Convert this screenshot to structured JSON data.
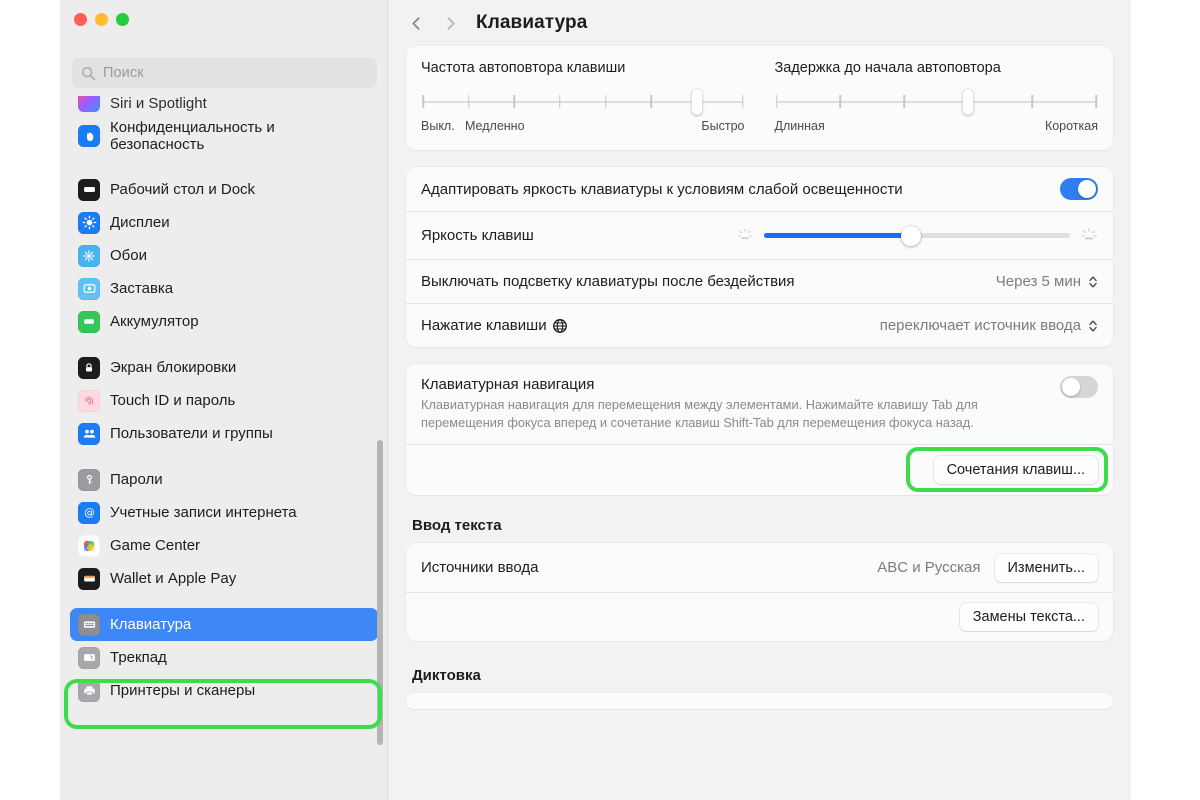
{
  "window": {
    "traffic_lights": [
      "close",
      "minimize",
      "zoom"
    ]
  },
  "sidebar": {
    "search": {
      "placeholder": "Поиск",
      "icon": "search-icon"
    },
    "items": [
      {
        "label": "Siri и Spotlight",
        "icon": "siri-icon",
        "clipped": true
      },
      {
        "label": "Конфиденциальность и безопасность",
        "icon": "privacy-hand-icon",
        "two_line": true
      },
      {
        "group_break": true
      },
      {
        "label": "Рабочий стол и Dock",
        "icon": "desktop-dock-icon"
      },
      {
        "label": "Дисплеи",
        "icon": "displays-icon"
      },
      {
        "label": "Обои",
        "icon": "wallpaper-icon"
      },
      {
        "label": "Заставка",
        "icon": "screensaver-icon"
      },
      {
        "label": "Аккумулятор",
        "icon": "battery-icon"
      },
      {
        "group_break": true
      },
      {
        "label": "Экран блокировки",
        "icon": "lock-screen-icon"
      },
      {
        "label": "Touch ID и пароль",
        "icon": "touch-id-icon"
      },
      {
        "label": "Пользователи и группы",
        "icon": "users-groups-icon"
      },
      {
        "group_break": true
      },
      {
        "label": "Пароли",
        "icon": "passwords-key-icon"
      },
      {
        "label": "Учетные записи интернета",
        "icon": "internet-accounts-icon"
      },
      {
        "label": "Game Center",
        "icon": "game-center-icon"
      },
      {
        "label": "Wallet и Apple Pay",
        "icon": "wallet-icon"
      },
      {
        "group_break": true
      },
      {
        "label": "Клавиатура",
        "icon": "keyboard-icon",
        "selected": true,
        "highlighted": true
      },
      {
        "label": "Трекпад",
        "icon": "trackpad-icon"
      },
      {
        "label": "Принтеры и сканеры",
        "icon": "printers-scanners-icon"
      }
    ]
  },
  "toolbar": {
    "back_icon": "chevron-left-icon",
    "forward_icon": "chevron-right-icon",
    "title": "Клавиатура"
  },
  "main": {
    "repeat_card": {
      "rate": {
        "caption": "Частота автоповтора клавиши",
        "ticks": 8,
        "thumb_index": 7,
        "labels": {
          "left": "Выкл.",
          "left2": "Медленно",
          "right": "Быстро"
        }
      },
      "delay": {
        "caption": "Задержка до начала автоповтора",
        "ticks": 6,
        "thumb_index": 4,
        "labels": {
          "left": "Длинная",
          "right": "Короткая"
        }
      }
    },
    "backlight_card": {
      "adapt_label": "Адаптировать яркость клавиатуры к условиям слабой освещенности",
      "adapt_on": true,
      "brightness_label": "Яркость клавиш",
      "brightness_percent": 48,
      "brightness_icon_low": "brightness-low-icon",
      "brightness_icon_high": "brightness-high-icon",
      "timeout_label": "Выключать подсветку клавиатуры после бездействия",
      "timeout_value": "Через 5 мин",
      "modifier_label": "Нажатие клавиши",
      "modifier_icon": "globe-icon",
      "modifier_value": "переключает источник ввода"
    },
    "navigation_card": {
      "title": "Клавиатурная навигация",
      "toggle_on": false,
      "description": "Клавиатурная навигация для перемещения между элементами. Нажимайте клавишу Tab для перемещения фокуса вперед и сочетание клавиш Shift-Tab для перемещения фокуса назад.",
      "shortcuts_button": "Сочетания клавиш...",
      "shortcuts_highlighted": true
    },
    "text_input": {
      "section_title": "Ввод текста",
      "sources_label": "Источники ввода",
      "sources_value": "ABC и Русская",
      "change_button": "Изменить...",
      "replacements_button": "Замены текста..."
    },
    "dictation": {
      "section_title": "Диктовка"
    }
  },
  "colors": {
    "accent_blue": "#3d87f6",
    "slider_blue": "#1a6ff0",
    "toggle_on": "#2f7ef0",
    "highlight_green": "#3ddc4b",
    "sidebar_bg": "#ededed",
    "content_bg": "#f2f2f2",
    "card_bg": "#fbfbfb"
  }
}
